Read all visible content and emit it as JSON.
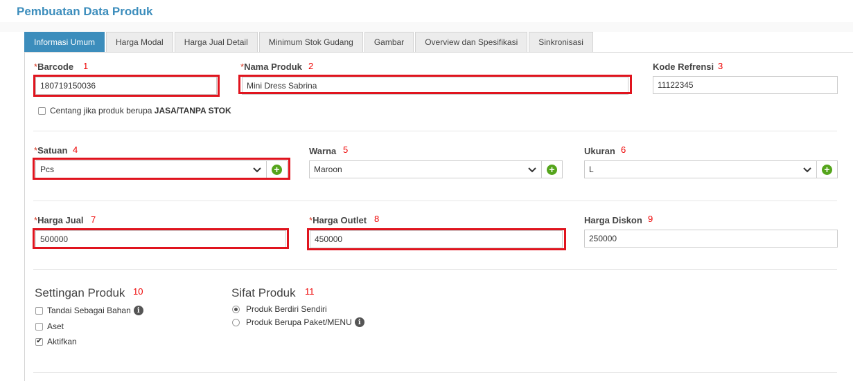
{
  "page_title": "Pembuatan Data Produk",
  "tabs": [
    {
      "label": "Informasi Umum",
      "active": true
    },
    {
      "label": "Harga Modal"
    },
    {
      "label": "Harga Jual Detail"
    },
    {
      "label": "Minimum Stok Gudang"
    },
    {
      "label": "Gambar"
    },
    {
      "label": "Overview dan Spesifikasi"
    },
    {
      "label": "Sinkronisasi"
    }
  ],
  "required_mark": "*",
  "fields": {
    "barcode": {
      "label": "Barcode",
      "value": "180719150036",
      "annotation": "1"
    },
    "nama_produk": {
      "label": "Nama Produk",
      "value": "Mini Dress Sabrina",
      "annotation": "2"
    },
    "kode_refrensi": {
      "label": "Kode Refrensi",
      "value": "11122345",
      "annotation": "3"
    },
    "jasa_checkbox": {
      "label_prefix": "Centang jika produk berupa",
      "label_bold": "JASA/TANPA STOK",
      "checked": false
    },
    "satuan": {
      "label": "Satuan",
      "value": "Pcs",
      "annotation": "4"
    },
    "warna": {
      "label": "Warna",
      "value": "Maroon",
      "annotation": "5"
    },
    "ukuran": {
      "label": "Ukuran",
      "value": "L",
      "annotation": "6"
    },
    "harga_jual": {
      "label": "Harga Jual",
      "value": "500000",
      "annotation": "7"
    },
    "harga_outlet": {
      "label": "Harga Outlet",
      "value": "450000",
      "annotation": "8"
    },
    "harga_diskon": {
      "label": "Harga Diskon",
      "value": "250000",
      "annotation": "9"
    }
  },
  "settingan_produk": {
    "title": "Settingan Produk",
    "annotation": "10",
    "options": [
      {
        "label": "Tandai Sebagai Bahan",
        "checked": false,
        "info_icon": "info-icon"
      },
      {
        "label": "Aset",
        "checked": false
      },
      {
        "label": "Aktifkan",
        "checked": true
      }
    ]
  },
  "sifat_produk": {
    "title": "Sifat Produk",
    "annotation": "11",
    "options": [
      {
        "label": "Produk Berdiri Sendiri",
        "selected": true
      },
      {
        "label": "Produk Berupa Paket/MENU",
        "selected": false,
        "info_icon": "info-icon"
      }
    ]
  },
  "colors": {
    "accent": "#3c8dbc",
    "highlight": "#e0141e",
    "add_button": "#55a51c",
    "required": "#d73925"
  },
  "icons": {
    "add": "plus-circle-icon",
    "dropdown": "chevron-down-icon",
    "info": "info-icon",
    "check": "check-icon"
  }
}
